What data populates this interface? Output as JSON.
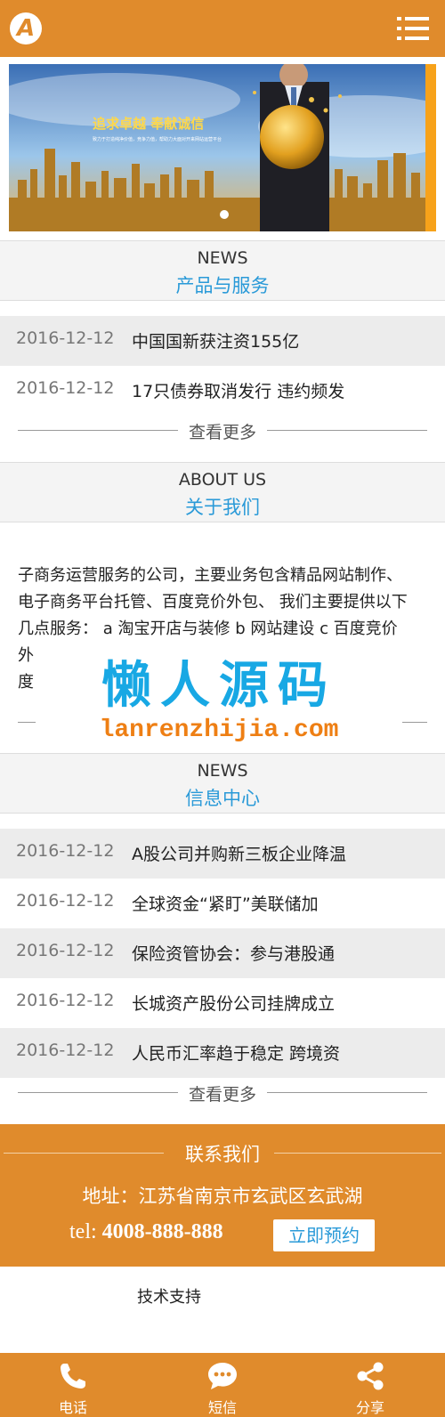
{
  "header": {
    "logo_letter": "A",
    "menu_icon": "menu-icon"
  },
  "banner": {
    "headline": "追求卓越 奉献诚信",
    "subline": "致力于打造纯净价值，竞争力值，帮助力大面对开来网站运营平台"
  },
  "news_section": {
    "title_en": "NEWS",
    "title_cn": "产品与服务",
    "items": [
      {
        "date": "2016-12-12",
        "title": "中国国新获注资155亿"
      },
      {
        "date": "2016-12-12",
        "title": "17只债券取消发行 违约频发"
      }
    ],
    "more_label": "查看更多"
  },
  "about_section": {
    "title_en": "ABOUT US",
    "title_cn": "关于我们",
    "lines": [
      "子商务运营服务的公司，主要业务包含精品网站制作、",
      "电子商务平台托管、百度竞价外包、 我们主要提供以下",
      "几点服务： a 淘宝开店与装修 b 网站建设 c 百度竞价",
      "外",
      "度"
    ]
  },
  "watermark": {
    "cn": "懒人源码",
    "en": "lanrenzhijia.com"
  },
  "info_section": {
    "title_en": "NEWS",
    "title_cn": "信息中心",
    "items": [
      {
        "date": "2016-12-12",
        "title": "A股公司并购新三板企业降温"
      },
      {
        "date": "2016-12-12",
        "title": "全球资金“紧盯”美联储加"
      },
      {
        "date": "2016-12-12",
        "title": "保险资管协会：参与港股通"
      },
      {
        "date": "2016-12-12",
        "title": "长城资产股份公司挂牌成立"
      },
      {
        "date": "2016-12-12",
        "title": "人民币汇率趋于稳定 跨境资"
      }
    ],
    "more_label": "查看更多"
  },
  "contact": {
    "title": "联系我们",
    "address": "地址：江苏省南京市玄武区玄武湖",
    "tel_label": "tel:",
    "tel": "4008-888-888",
    "book_button": "立即预约"
  },
  "support": {
    "label": "技术支持"
  },
  "footer": {
    "items": [
      {
        "label": "电话",
        "icon": "phone-icon"
      },
      {
        "label": "短信",
        "icon": "sms-icon"
      },
      {
        "label": "分享",
        "icon": "share-icon"
      }
    ]
  },
  "colors": {
    "brand": "#e08b2c",
    "accent_blue": "#2a9ad8",
    "row_gray": "#ececec"
  }
}
